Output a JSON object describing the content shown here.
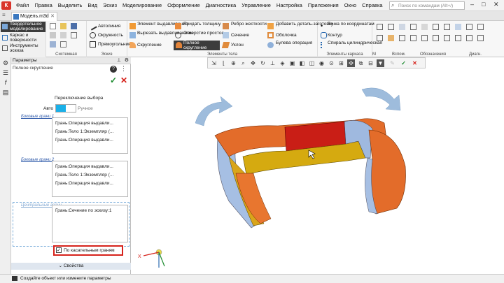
{
  "menu": {
    "logo": "К",
    "items": [
      "Файл",
      "Правка",
      "Выделить",
      "Вид",
      "Эскиз",
      "Моделирование",
      "Оформление",
      "Диагностика",
      "Управление",
      "Настройка",
      "Приложения",
      "Окно",
      "Справка"
    ],
    "search_placeholder": "Поиск по командам (Alt+/)"
  },
  "tabs": {
    "document": "Модель.m3d"
  },
  "ribbon": {
    "modes": [
      "Твердотельное моделирование",
      "Каркас и поверхности",
      "Инструменты эскиза"
    ],
    "group_system": "Системная",
    "group_sketch": "Эскиз",
    "group_body": "Элементы тела",
    "group_frame": "Элементы каркаса",
    "group_more": [
      "М",
      "Вспом.",
      "Обозначения",
      "Диагн."
    ],
    "sketch_items": [
      "Автолиния",
      "Окружность",
      "Прямоугольник"
    ],
    "body_items_a": [
      "Элемент выдавливания",
      "Вырезать выдавливанием",
      "Скругление"
    ],
    "body_items_b": [
      "Придать толщину",
      "Отверстие простое",
      "Полное скругление"
    ],
    "body_items_c": [
      "Ребро жесткости",
      "Сечение",
      "Уклон"
    ],
    "body_items_d": [
      "Добавить деталь-заготовку",
      "Оболочка",
      "Булева операция"
    ],
    "frame_items": [
      "Точка по координатам",
      "Контур",
      "Спираль цилиндрическая"
    ]
  },
  "panel": {
    "title": "Параметры",
    "operation": "Полное скругление",
    "selection_header": "Переключение выбора",
    "toggle_left": "Авто",
    "toggle_right": "Ручное",
    "section1_label": "Боковые грани 1",
    "section1_rows": [
      "Грань:Операция выдавли...",
      "Грань:Тело 1:Экземпляр (...",
      "Грань:Операция выдавли..."
    ],
    "section2_label": "Боковые грани 2",
    "section2_rows": [
      "Грань:Операция выдавли...",
      "Грань:Тело 1:Экземпляр (...",
      "Грань:Операция выдавли..."
    ],
    "section3_label": "Центральные грани",
    "section3_rows": [
      "Грань:Сечение по эскизу:1"
    ],
    "tangent_checkbox": "По касательным граням",
    "properties": "Свойства"
  },
  "status": {
    "text": "Создайте объект или измените параметры"
  },
  "triad": {
    "x_label": "X"
  },
  "colors": {
    "accent": "#1ab0e8",
    "highlight": "#d6221b",
    "body": "#e36c2a",
    "body_blue": "#a6bfe3"
  }
}
